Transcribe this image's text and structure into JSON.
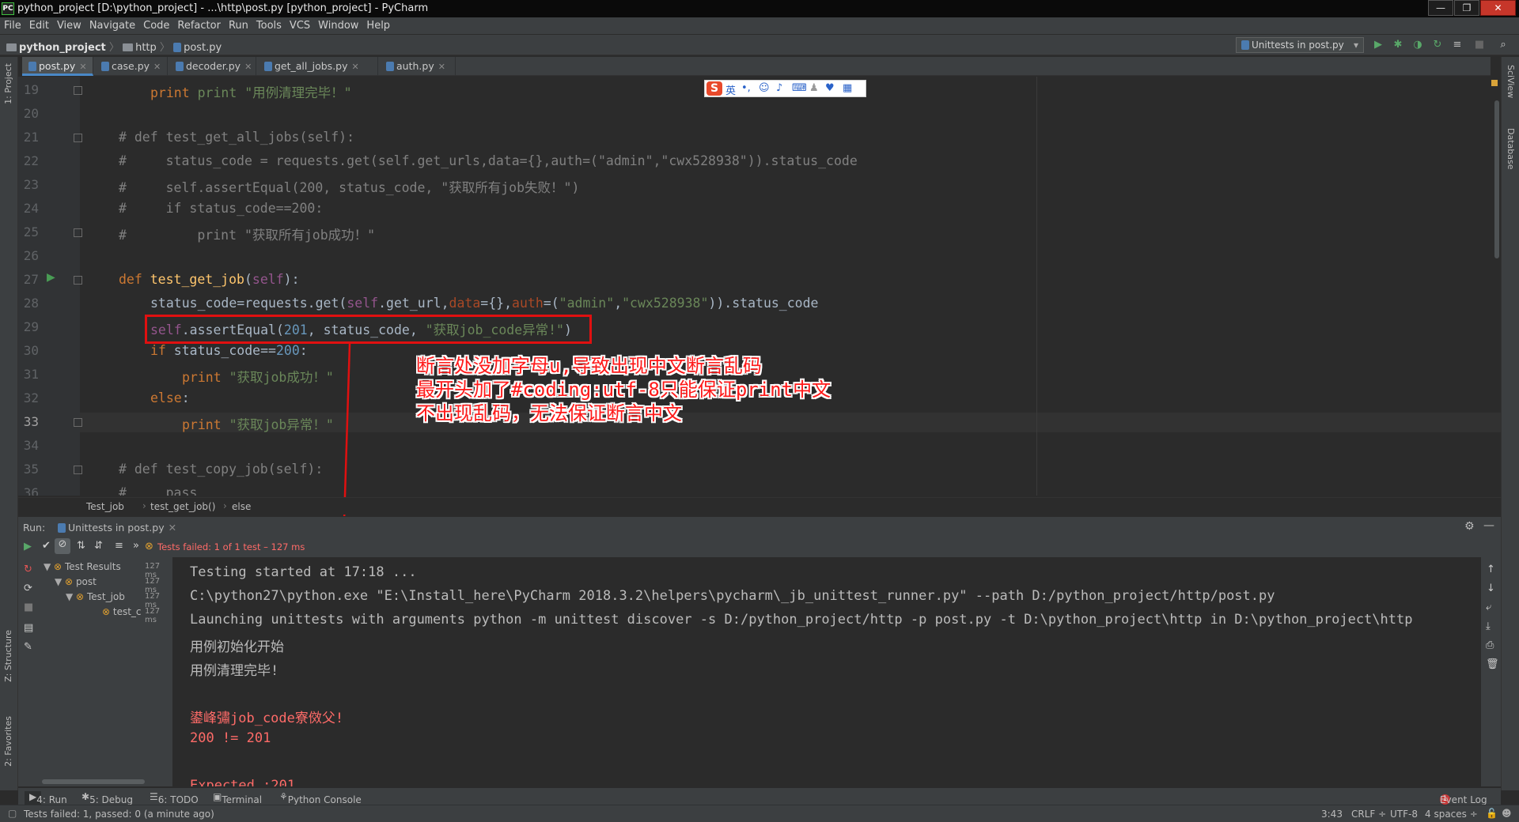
{
  "window": {
    "title": "python_project [D:\\python_project] - ...\\http\\post.py [python_project] - PyCharm",
    "app_icon_text": "PC",
    "min": "—",
    "max": "❐",
    "close": "✕"
  },
  "menu": [
    "File",
    "Edit",
    "View",
    "Navigate",
    "Code",
    "Refactor",
    "Run",
    "Tools",
    "VCS",
    "Window",
    "Help"
  ],
  "navbar": {
    "project": "python_project",
    "folder": "http",
    "file": "post.py",
    "run_config": "Unittests in post.py"
  },
  "tabs": [
    {
      "label": "post.py",
      "active": true
    },
    {
      "label": "case.py",
      "active": false
    },
    {
      "label": "decoder.py",
      "active": false
    },
    {
      "label": "get_all_jobs.py",
      "active": false
    },
    {
      "label": "auth.py",
      "active": false
    }
  ],
  "left_stripe": {
    "project": "1: Project",
    "structure": "Z: Structure",
    "favorites": "2: Favorites"
  },
  "right_stripe": {
    "sciview": "SciView",
    "database": "Database"
  },
  "ime": {
    "lang": "英",
    "punct": "•,"
  },
  "code": {
    "lines": [
      "19",
      "20",
      "21",
      "22",
      "23",
      "24",
      "25",
      "26",
      "27",
      "28",
      "29",
      "30",
      "31",
      "32",
      "33",
      "34",
      "35",
      "36"
    ],
    "l19": "print \"用例清理完毕！\"",
    "l21": "# def test_get_all_jobs(self):",
    "l22": "#     status_code = requests.get(self.get_urls,data={},auth=(\"admin\",\"cwx528938\")).status_code",
    "l23": "#     self.assertEqual(200, status_code, \"获取所有job失败！\")",
    "l24": "#     if status_code==200:",
    "l25": "#         print \"获取所有job成功！\"",
    "l27_kw": "def",
    "l27_fn": "test_get_job",
    "l27_self": "self",
    "l28_a": "status_code=requests.get(",
    "l28_self": "self",
    "l28_b": ".get_url,",
    "l28_data": "data",
    "l28_c": "={},",
    "l28_auth": "auth",
    "l28_d": "=(",
    "l28_s1": "\"admin\"",
    "l28_e": ",",
    "l28_s2": "\"cwx528938\"",
    "l28_f": ")).status_code",
    "l29_self": "self",
    "l29_a": ".assertEqual(",
    "l29_num": "201",
    "l29_b": ", status_code, ",
    "l29_str": "\"获取job_code异常!\"",
    "l29_c": ")",
    "l30_kw": "if",
    "l30_a": " status_code==",
    "l30_num": "200",
    "l30_b": ":",
    "l31_kw": "print",
    "l31_str": "\"获取job成功！\"",
    "l32_kw": "else",
    "l33_kw": "print",
    "l33_str": "\"获取job异常！\"",
    "l35": "# def test_copy_job(self):",
    "l36": "#     pass"
  },
  "annotation": {
    "line1": "断言处没加字母u,导致出现中文断言乱码",
    "line2": "最开头加了#coding:utf-8只能保证print中文",
    "line3": "不出现乱码，无法保证断言中文"
  },
  "editor_breadcrumb": [
    "Test_job",
    "test_get_job()",
    "else"
  ],
  "run_panel": {
    "label": "Run:",
    "tab": "Unittests in post.py",
    "status": "Tests failed: 1 of 1 test – 127 ms",
    "tree": [
      {
        "name": "Test Results",
        "time": "127 ms"
      },
      {
        "name": "post",
        "time": "127 ms"
      },
      {
        "name": "Test_job",
        "time": "127 ms"
      },
      {
        "name": "test_c",
        "time": "127 ms"
      }
    ],
    "console": [
      "Testing started at 17:18 ...",
      "C:\\python27\\python.exe \"E:\\Install_here\\PyCharm 2018.3.2\\helpers\\pycharm\\_jb_unittest_runner.py\" --path D:/python_project/http/post.py",
      "Launching unittests with arguments python -m unittest discover -s D:/python_project/http -p post.py -t D:\\python_project\\http in D:\\python_project\\http",
      "用例初始化开始",
      "用例清理完毕!",
      "",
      "鍙峰彇job_code寮傚父!",
      "200 != 201",
      "",
      "Expected :201"
    ]
  },
  "tool_tabs": [
    "4: Run",
    "5: Debug",
    "6: TODO",
    "Terminal",
    "Python Console"
  ],
  "event_log": {
    "count": "1",
    "label": "Event Log"
  },
  "statusbar": {
    "message": "Tests failed: 1, passed: 0 (a minute ago)",
    "position": "3:43",
    "line_sep": "CRLF ÷",
    "encoding": "UTF-8",
    "indent": "4 spaces ÷"
  },
  "colors": {
    "accent": "#4a88c7",
    "error": "#ff6b68",
    "annotation_red": "#e01010"
  }
}
